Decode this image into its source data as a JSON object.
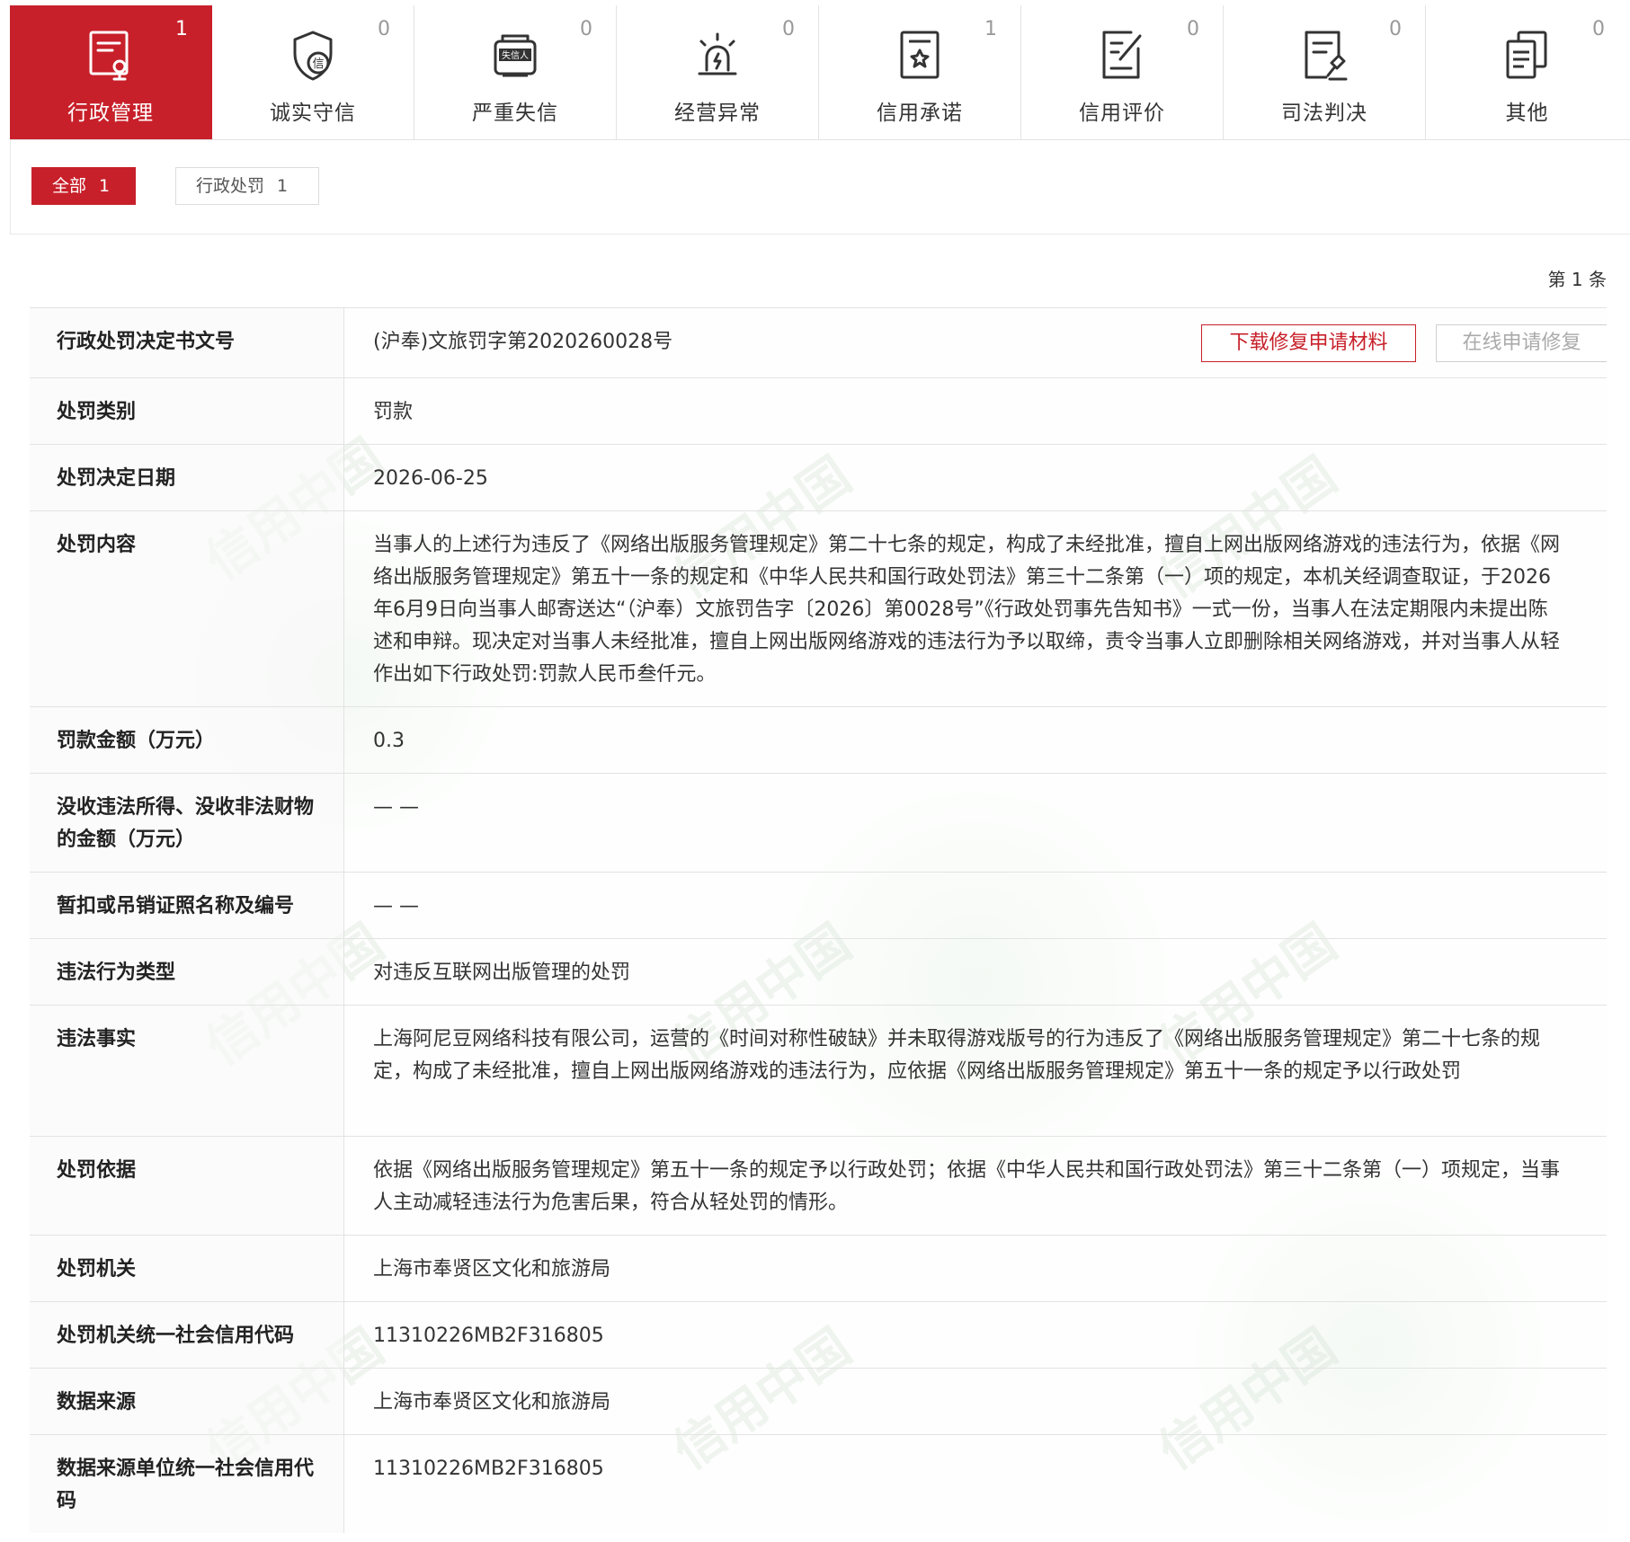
{
  "tabs": [
    {
      "label": "行政管理",
      "count": "1",
      "icon": "admin-management-icon",
      "active": true
    },
    {
      "label": "诚实守信",
      "count": "0",
      "icon": "honesty-shield-icon"
    },
    {
      "label": "严重失信",
      "count": "0",
      "icon": "dishonest-person-icon",
      "icon_text": "失信人"
    },
    {
      "label": "经营异常",
      "count": "0",
      "icon": "alarm-light-icon"
    },
    {
      "label": "信用承诺",
      "count": "1",
      "icon": "commitment-document-icon"
    },
    {
      "label": "信用评价",
      "count": "0",
      "icon": "evaluation-document-icon"
    },
    {
      "label": "司法判决",
      "count": "0",
      "icon": "judgment-document-icon"
    },
    {
      "label": "其他",
      "count": "0",
      "icon": "other-document-icon"
    }
  ],
  "filters": {
    "all_label": "全部",
    "all_count": "1",
    "penalty_label": "行政处罚",
    "penalty_count": "1"
  },
  "record_index": "第 1 条",
  "watermark": "信用中国",
  "actions": {
    "download": "下载修复申请材料",
    "online": "在线申请修复"
  },
  "accent_color": "#c8202a",
  "rows": [
    {
      "label": "行政处罚决定书文号",
      "value": "(沪奉)文旅罚字第2020260028号"
    },
    {
      "label": "处罚类别",
      "value": "罚款"
    },
    {
      "label": "处罚决定日期",
      "value": "2026-06-25"
    },
    {
      "label": "处罚内容",
      "value": "当事人的上述行为违反了《网络出版服务管理规定》第二十七条的规定，构成了未经批准，擅自上网出版网络游戏的违法行为，依据《网络出版服务管理规定》第五十一条的规定和《中华人民共和国行政处罚法》第三十二条第（一）项的规定，本机关经调查取证，于2026年6月9日向当事人邮寄送达“（沪奉）文旅罚告字〔2026〕第0028号”《行政处罚事先告知书》一式一份，当事人在法定期限内未提出陈述和申辩。现决定对当事人未经批准，擅自上网出版网络游戏的违法行为予以取缔，责令当事人立即删除相关网络游戏，并对当事人从轻作出如下行政处罚:罚款人民币叁仟元。"
    },
    {
      "label": "罚款金额（万元）",
      "value": "0.3"
    },
    {
      "label": "没收违法所得、没收非法财物的金额（万元）",
      "value": "— —"
    },
    {
      "label": "暂扣或吊销证照名称及编号",
      "value": "— —"
    },
    {
      "label": "违法行为类型",
      "value": "对违反互联网出版管理的处罚"
    },
    {
      "label": "违法事实",
      "value": "上海阿尼豆网络科技有限公司，运营的《时间对称性破缺》并未取得游戏版号的行为违反了《网络出版服务管理规定》第二十七条的规定，构成了未经批准，擅自上网出版网络游戏的违法行为，应依据《网络出版服务管理规定》第五十一条的规定予以行政处罚"
    },
    {
      "label": "处罚依据",
      "value": "依据《网络出版服务管理规定》第五十一条的规定予以行政处罚；依据《中华人民共和国行政处罚法》第三十二条第（一）项规定，当事人主动减轻违法行为危害后果，符合从轻处罚的情形。"
    },
    {
      "label": "处罚机关",
      "value": "上海市奉贤区文化和旅游局"
    },
    {
      "label": "处罚机关统一社会信用代码",
      "value": "11310226MB2F316805"
    },
    {
      "label": "数据来源",
      "value": "上海市奉贤区文化和旅游局"
    },
    {
      "label": "数据来源单位统一社会信用代码",
      "value": "11310226MB2F316805"
    }
  ]
}
